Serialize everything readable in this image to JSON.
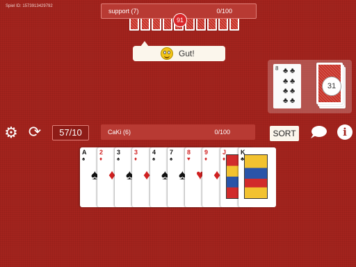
{
  "game_id": "Spiel ID: 1573913429792",
  "opponent": {
    "name": "support (7)",
    "score": "0/100",
    "cards_badge": "91"
  },
  "bubble": {
    "text": "Gut!"
  },
  "deck": {
    "stock_count": "31",
    "trump_rank": "8",
    "trump_suit": "♣"
  },
  "controls": {
    "counter": "57/10",
    "sort_label": "SORT",
    "info_label": "i"
  },
  "player": {
    "name": "CaKi (6)",
    "score": "0/100"
  },
  "hand": [
    {
      "rank": "A",
      "suit": "♠",
      "color": "black"
    },
    {
      "rank": "2",
      "suit": "♦",
      "color": "red"
    },
    {
      "rank": "3",
      "suit": "♠",
      "color": "black"
    },
    {
      "rank": "3",
      "suit": "♦",
      "color": "red"
    },
    {
      "rank": "4",
      "suit": "♠",
      "color": "black"
    },
    {
      "rank": "7",
      "suit": "♠",
      "color": "black"
    },
    {
      "rank": "8",
      "suit": "♥",
      "color": "red"
    },
    {
      "rank": "9",
      "suit": "♦",
      "color": "red"
    },
    {
      "rank": "J",
      "suit": "♦",
      "color": "red"
    },
    {
      "rank": "K",
      "suit": "♣",
      "color": "black"
    }
  ],
  "colors": {
    "table": "#a3231d",
    "card_back": "#c83228",
    "bubble": "#fbf6ec"
  }
}
